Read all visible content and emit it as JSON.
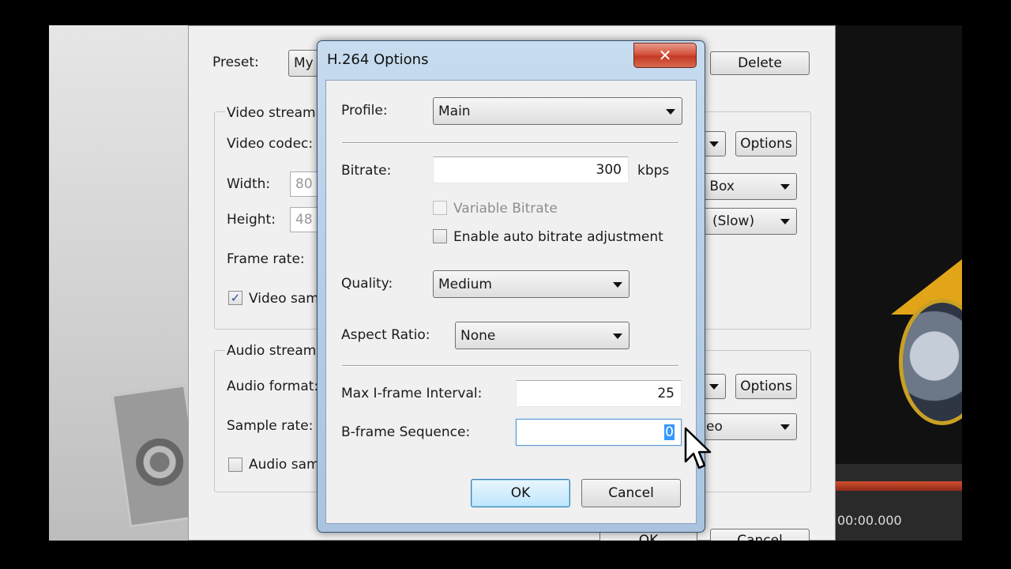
{
  "background": {
    "preset_label": "Preset:",
    "preset_value": "My",
    "delete_button": "Delete",
    "video_stream_label": "Video stream",
    "video_codec_label": "Video codec:",
    "options_button_1": "Options",
    "width_label": "Width:",
    "width_value": "80",
    "height_label": "Height:",
    "height_value": "48",
    "resize_value": "r Box",
    "speed_value": "(Slow)",
    "frame_rate_label": "Frame rate:",
    "video_same_label": "Video sam",
    "audio_stream_label": "Audio stream",
    "audio_format_label": "Audio format:",
    "options_button_2": "Options",
    "sample_rate_label": "Sample rate:",
    "sample_rate_value": "eo",
    "audio_same_label": "Audio sam",
    "ok_button": "OK",
    "cancel_button": "Cancel",
    "time_readout": "00:00.000"
  },
  "dialog": {
    "title": "H.264 Options",
    "close_glyph": "✕",
    "profile_label": "Profile:",
    "profile_value": "Main",
    "bitrate_label": "Bitrate:",
    "bitrate_value": "300",
    "bitrate_unit": "kbps",
    "variable_bitrate_label": "Variable Bitrate",
    "auto_bitrate_label": "Enable auto bitrate adjustment",
    "quality_label": "Quality:",
    "quality_value": "Medium",
    "aspect_ratio_label": "Aspect Ratio:",
    "aspect_ratio_value": "None",
    "max_iframe_label": "Max I-frame Interval:",
    "max_iframe_value": "25",
    "bframe_label": "B-frame Sequence:",
    "bframe_value": "0",
    "ok_button": "OK",
    "cancel_button": "Cancel"
  },
  "colors": {
    "dialog_frame": "#b7cfe8",
    "close_button": "#c33a24",
    "selection": "#3399ff"
  }
}
